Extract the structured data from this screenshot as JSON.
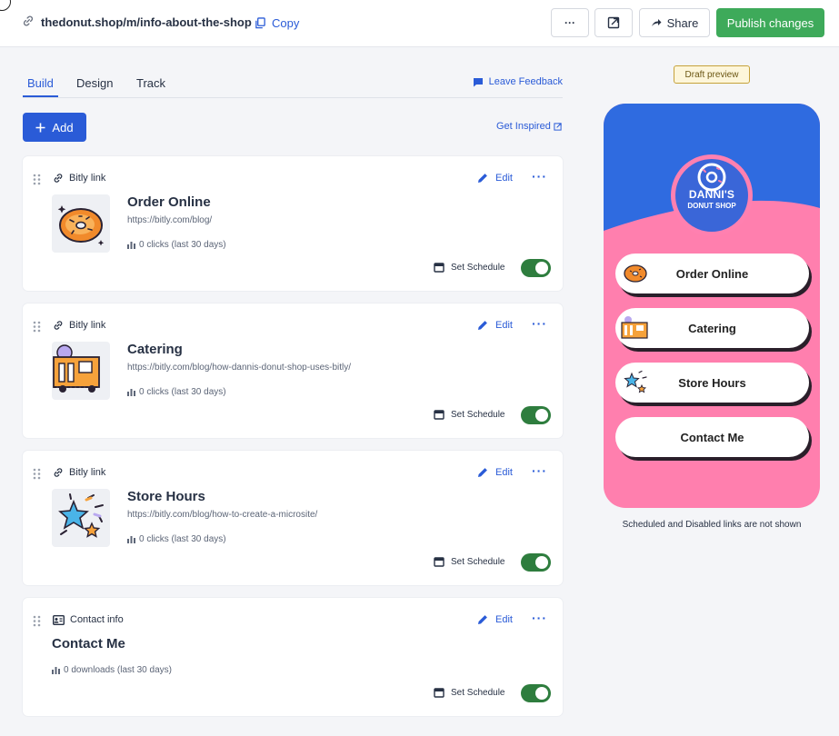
{
  "topbar": {
    "url": "thedonut.shop/m/info-about-the-shop",
    "copy_label": "Copy",
    "more_label": "···",
    "share_label": "Share",
    "publish_label": "Publish changes"
  },
  "tabs": [
    {
      "label": "Build",
      "active": true
    },
    {
      "label": "Design",
      "active": false
    },
    {
      "label": "Track",
      "active": false
    }
  ],
  "feedback_label": "Leave Feedback",
  "add_label": "Add",
  "inspired_label": "Get Inspired",
  "cards": [
    {
      "type": "Bitly link",
      "title": "Order Online",
      "url": "https://bitly.com/blog/",
      "stats": "0 clicks (last 30 days)",
      "thumb": "donut-icon",
      "edit": "Edit",
      "schedule": "Set Schedule",
      "enabled": true
    },
    {
      "type": "Bitly link",
      "title": "Catering",
      "url": "https://bitly.com/blog/how-dannis-donut-shop-uses-bitly/",
      "stats": "0 clicks (last 30 days)",
      "thumb": "truck-icon",
      "edit": "Edit",
      "schedule": "Set Schedule",
      "enabled": true
    },
    {
      "type": "Bitly link",
      "title": "Store Hours",
      "url": "https://bitly.com/blog/how-to-create-a-microsite/",
      "stats": "0 clicks (last 30 days)",
      "thumb": "stars-icon",
      "edit": "Edit",
      "schedule": "Set Schedule",
      "enabled": true
    },
    {
      "type": "Contact info",
      "title": "Contact Me",
      "url": "",
      "stats": "0 downloads (last 30 days)",
      "thumb": "",
      "edit": "Edit",
      "schedule": "Set Schedule",
      "enabled": true
    }
  ],
  "preview": {
    "badge": "Draft preview",
    "logo_name": "DANNI'S",
    "logo_sub": "DONUT SHOP",
    "buttons": [
      "Order Online",
      "Catering",
      "Store Hours",
      "Contact Me"
    ],
    "note": "Scheduled and Disabled links are not shown",
    "top_color": "#2f6be0",
    "bottom_color": "#ff7fae"
  }
}
